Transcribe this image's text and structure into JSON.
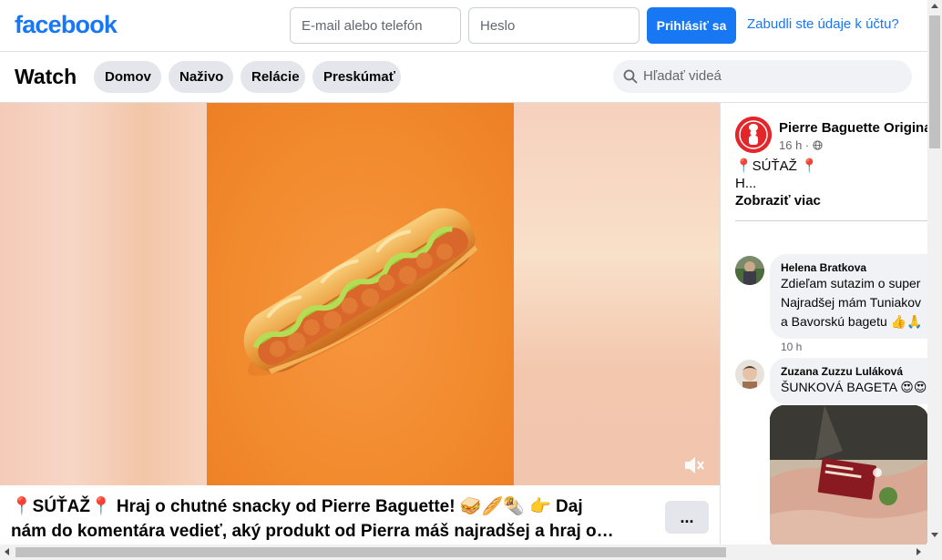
{
  "header": {
    "logo_text": "facebook",
    "email_placeholder": "E-mail alebo telefón",
    "password_placeholder": "Heslo",
    "login_label": "Prihlásiť sa",
    "forgot_label": "Zabudli ste údaje k účtu?",
    "brand_color": "#1877f2"
  },
  "watch_nav": {
    "title": "Watch",
    "tabs": [
      {
        "label": "Domov"
      },
      {
        "label": "Naživo"
      },
      {
        "label": "Relácie"
      },
      {
        "label": "Preskúmať"
      }
    ],
    "search_placeholder": "Hľadať videá"
  },
  "video": {
    "caption_line1": "📍SÚŤAŽ📍 Hraj o chutné snacky od Pierre Baguette! 🥪🥖🌯 👉 Daj",
    "caption_line2": "nám do komentára vedieť, aký produkt od Pierra máš najradšej a hraj o…",
    "more_label": "...",
    "mute_icon": "speaker-muted-icon"
  },
  "post": {
    "page_name": "Pierre Baguette Original",
    "time": "16 h ·",
    "privacy_icon": "globe-icon",
    "text_line1": "📍SÚŤAŽ 📍",
    "text_line2": "H...",
    "see_more": "Zobraziť viac"
  },
  "comments": [
    {
      "author": "Helena Bratkova",
      "lines": [
        "Zdieľam sutazim o super",
        "Najradšej mám Tuniakov",
        "a Bavorskú bagetu 👍🙏"
      ],
      "time": "10 h"
    },
    {
      "author": "Zuzana Zuzzu Luláková",
      "lines": [
        "ŠUNKOVÁ BAGETA 😍😍"
      ]
    }
  ]
}
